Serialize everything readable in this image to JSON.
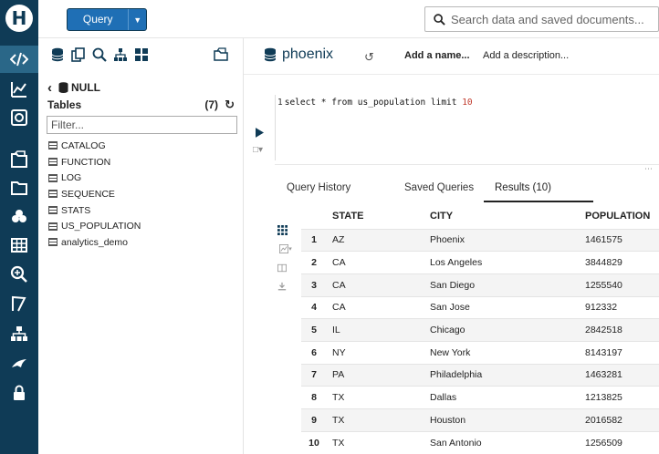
{
  "app": {
    "logo_letter": "H"
  },
  "topbar": {
    "query_button_label": "Query",
    "search_placeholder": "Search data and saved documents..."
  },
  "assist": {
    "database": "NULL",
    "tables_label": "Tables",
    "tables_count": "(7)",
    "filter_placeholder": "Filter...",
    "tables": [
      "CATALOG",
      "FUNCTION",
      "LOG",
      "SEQUENCE",
      "STATS",
      "US_POPULATION",
      "analytics_demo"
    ]
  },
  "editor": {
    "db_name": "phoenix",
    "add_name": "Add a name...",
    "add_description": "Add a description...",
    "line_number": "1",
    "query_text": "select * from us_population limit ",
    "query_limit": "10"
  },
  "results": {
    "tabs": [
      "Query History",
      "Saved Queries",
      "Results (10)"
    ],
    "columns": [
      "STATE",
      "CITY",
      "POPULATION"
    ],
    "rows": [
      [
        "1",
        "AZ",
        "Phoenix",
        "1461575"
      ],
      [
        "2",
        "CA",
        "Los Angeles",
        "3844829"
      ],
      [
        "3",
        "CA",
        "San Diego",
        "1255540"
      ],
      [
        "4",
        "CA",
        "San Jose",
        "912332"
      ],
      [
        "5",
        "IL",
        "Chicago",
        "2842518"
      ],
      [
        "6",
        "NY",
        "New York",
        "8143197"
      ],
      [
        "7",
        "PA",
        "Philadelphia",
        "1463281"
      ],
      [
        "8",
        "TX",
        "Dallas",
        "1213825"
      ],
      [
        "9",
        "TX",
        "Houston",
        "2016582"
      ],
      [
        "10",
        "TX",
        "San Antonio",
        "1256509"
      ]
    ]
  },
  "colors": {
    "rail": "#0f3b56",
    "rail_active": "#2a6788",
    "primary": "#1f6fb5"
  }
}
